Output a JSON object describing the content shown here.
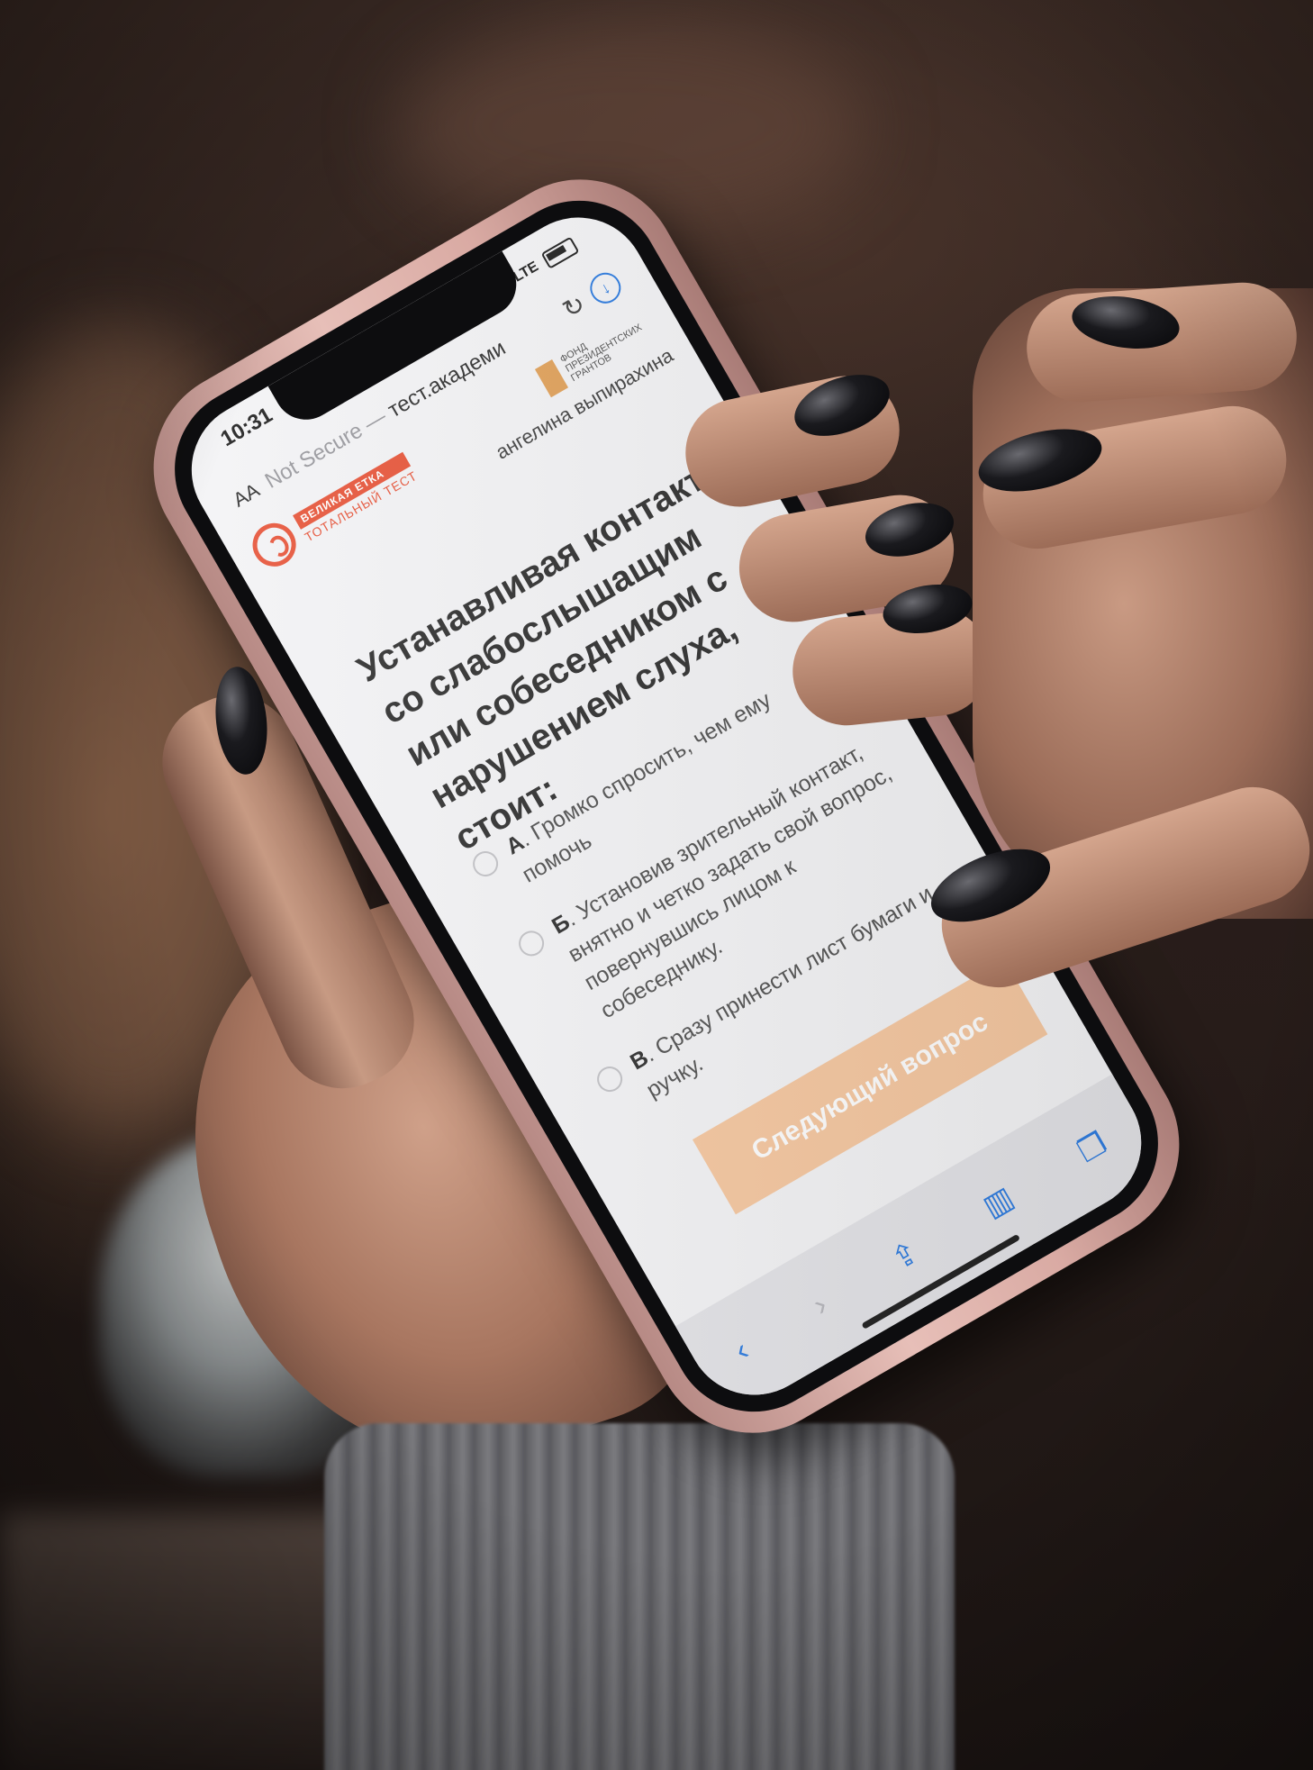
{
  "status_bar": {
    "time": "10:31",
    "network": "LTE"
  },
  "browser": {
    "text_size_label": "AA",
    "security_label": "Not Secure",
    "separator": "—",
    "domain": "тест.академи",
    "reload_icon": "reload-icon",
    "download_icon": "download-icon"
  },
  "page": {
    "logo_tag": "ВЕЛИКАЯ ЕТКА",
    "logo_sub": "ТОТАЛЬНЫЙ ТЕСТ",
    "fund_name": "ФОНД ПРЕЗИДЕНТСКИХ ГРАНТОВ",
    "username": "ангелина выпирахина",
    "question": "Устанавливая контакт со слабослышащим или собеседником с нарушением слуха, стоит:",
    "answers": [
      {
        "letter": "А",
        "text": ". Громко спросить, чем ему помочь"
      },
      {
        "letter": "Б",
        "text": ". Установив зрительный контакт, внятно и четко задать свой вопрос, повернувшись лицом к собеседнику."
      },
      {
        "letter": "В",
        "text": ". Сразу принести лист бумаги и ручку."
      }
    ],
    "next_button": "Следующий вопрос"
  },
  "toolbar": {
    "back_icon": "back-arrow-icon",
    "forward_icon": "forward-arrow-icon",
    "share_icon": "share-icon",
    "bookmarks_icon": "book-icon",
    "tabs_icon": "tabs-icon"
  },
  "colors": {
    "accent": "#e8573c",
    "button": "#f7c9a2",
    "case": "#e7bfb8",
    "nail_polish": "#0b0b0e"
  }
}
